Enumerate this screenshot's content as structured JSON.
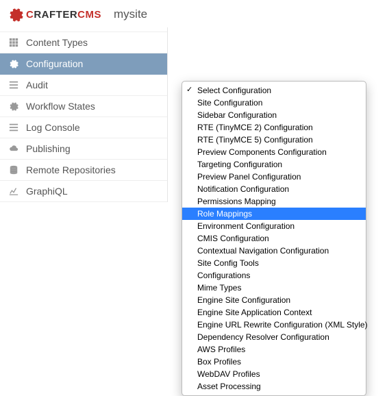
{
  "header": {
    "logo_text_prefix": "C",
    "logo_text_rest": "RAFTER",
    "logo_text_suffix": "CMS",
    "brand_red": "#c4302b",
    "site_name": "mysite"
  },
  "sidebar": {
    "items": [
      {
        "label": "Content Types",
        "icon": "grid-icon",
        "active": false
      },
      {
        "label": "Configuration",
        "icon": "gear-icon",
        "active": true
      },
      {
        "label": "Audit",
        "icon": "list-icon",
        "active": false
      },
      {
        "label": "Workflow States",
        "icon": "gear-icon",
        "active": false
      },
      {
        "label": "Log Console",
        "icon": "list-icon",
        "active": false
      },
      {
        "label": "Publishing",
        "icon": "cloud-icon",
        "active": false
      },
      {
        "label": "Remote Repositories",
        "icon": "database-icon",
        "active": false
      },
      {
        "label": "GraphiQL",
        "icon": "chart-icon",
        "active": false
      }
    ]
  },
  "dropdown": {
    "items": [
      {
        "label": "Select Configuration",
        "selected": true,
        "highlight": false
      },
      {
        "label": "Site Configuration",
        "selected": false,
        "highlight": false
      },
      {
        "label": "Sidebar Configuration",
        "selected": false,
        "highlight": false
      },
      {
        "label": "RTE (TinyMCE 2) Configuration",
        "selected": false,
        "highlight": false
      },
      {
        "label": "RTE (TinyMCE 5) Configuration",
        "selected": false,
        "highlight": false
      },
      {
        "label": "Preview Components Configuration",
        "selected": false,
        "highlight": false
      },
      {
        "label": "Targeting Configuration",
        "selected": false,
        "highlight": false
      },
      {
        "label": "Preview Panel Configuration",
        "selected": false,
        "highlight": false
      },
      {
        "label": "Notification Configuration",
        "selected": false,
        "highlight": false
      },
      {
        "label": "Permissions Mapping",
        "selected": false,
        "highlight": false
      },
      {
        "label": "Role Mappings",
        "selected": false,
        "highlight": true
      },
      {
        "label": "Environment Configuration",
        "selected": false,
        "highlight": false
      },
      {
        "label": "CMIS Configuration",
        "selected": false,
        "highlight": false
      },
      {
        "label": "Contextual Navigation Configuration",
        "selected": false,
        "highlight": false
      },
      {
        "label": "Site Config Tools",
        "selected": false,
        "highlight": false
      },
      {
        "label": "Configurations",
        "selected": false,
        "highlight": false
      },
      {
        "label": "Mime Types",
        "selected": false,
        "highlight": false
      },
      {
        "label": "Engine Site Configuration",
        "selected": false,
        "highlight": false
      },
      {
        "label": "Engine Site Application Context",
        "selected": false,
        "highlight": false
      },
      {
        "label": "Engine URL Rewrite Configuration (XML Style)",
        "selected": false,
        "highlight": false
      },
      {
        "label": "Dependency Resolver Configuration",
        "selected": false,
        "highlight": false
      },
      {
        "label": "AWS Profiles",
        "selected": false,
        "highlight": false
      },
      {
        "label": "Box Profiles",
        "selected": false,
        "highlight": false
      },
      {
        "label": "WebDAV Profiles",
        "selected": false,
        "highlight": false
      },
      {
        "label": "Asset Processing",
        "selected": false,
        "highlight": false
      }
    ]
  },
  "icons": {
    "grid-icon": "<svg viewBox='0 0 16 16' width='14' height='14'><rect x='1' y='1' width='4' height='4' fill='currentColor'/><rect x='6' y='1' width='4' height='4' fill='currentColor'/><rect x='11' y='1' width='4' height='4' fill='currentColor'/><rect x='1' y='6' width='4' height='4' fill='currentColor'/><rect x='6' y='6' width='4' height='4' fill='currentColor'/><rect x='11' y='6' width='4' height='4' fill='currentColor'/><rect x='1' y='11' width='4' height='4' fill='currentColor'/><rect x='6' y='11' width='4' height='4' fill='currentColor'/><rect x='11' y='11' width='4' height='4' fill='currentColor'/></svg>",
    "gear-icon": "<svg viewBox='0 0 16 16' width='14' height='14'><path fill='currentColor' d='M8 10.5A2.5 2.5 0 1 0 8 5.5a2.5 2.5 0 0 0 0 5zm6.4-2.5l1.3-1-.9-2.2-1.6.3a5 5 0 0 0-.9-.9l.3-1.6-2.2-.9-1 1.3a5 5 0 0 0-1.3 0l-1-1.3-2.2.9.3 1.6a5 5 0 0 0-.9.9l-1.6-.3-.9 2.2 1.3 1a5 5 0 0 0 0 1.3l-1.3 1 .9 2.2 1.6-.3c.3.3.6.6.9.9l-.3 1.6 2.2.9 1-1.3a5 5 0 0 0 1.3 0l1 1.3 2.2-.9-.3-1.6c.3-.3.6-.6.9-.9l1.6.3.9-2.2-1.3-1a5 5 0 0 0 0-1.3z'/></svg>",
    "list-icon": "<svg viewBox='0 0 16 16' width='14' height='14'><rect x='1' y='2' width='14' height='2' fill='currentColor'/><rect x='1' y='7' width='14' height='2' fill='currentColor'/><rect x='1' y='12' width='14' height='2' fill='currentColor'/></svg>",
    "cloud-icon": "<svg viewBox='0 0 16 16' width='14' height='14'><path fill='currentColor' d='M12.5 6.5a4 4 0 0 0-7.8-1A3 3 0 0 0 4 11.5h8.5a2.5 2.5 0 0 0 0-5z'/></svg>",
    "database-icon": "<svg viewBox='0 0 16 16' width='14' height='14'><ellipse cx='8' cy='3' rx='6' ry='2' fill='currentColor'/><path fill='currentColor' d='M2 3v4c0 1.1 2.7 2 6 2s6-.9 6-2V3c0 1.1-2.7 2-6 2s-6-.9-6-2z'/><path fill='currentColor' d='M2 7v4c0 1.1 2.7 2 6 2s6-.9 6-2V7c0 1.1-2.7 2-6 2s-6-.9-6-2z'/><path fill='currentColor' d='M2 11v2c0 1.1 2.7 2 6 2s6-.9 6-2v-2c0 1.1-2.7 2-6 2s-6-.9-6-2z'/></svg>",
    "chart-icon": "<svg viewBox='0 0 16 16' width='14' height='14'><path fill='none' stroke='currentColor' stroke-width='1.5' d='M1 14h14M2 12l3-5 3 3 4-7'/></svg>"
  }
}
